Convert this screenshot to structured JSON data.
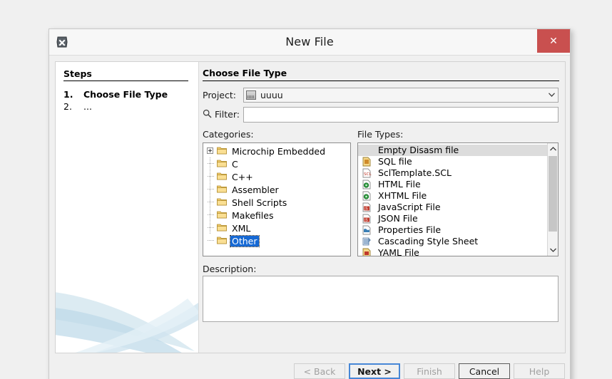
{
  "window": {
    "title": "New File",
    "icon": "app-badge-icon",
    "close_label": "✕",
    "close_color": "#c9504f"
  },
  "steps": {
    "heading": "Steps",
    "items": [
      {
        "number": "1.",
        "label": "Choose File Type"
      },
      {
        "number": "2.",
        "label": "..."
      }
    ]
  },
  "main": {
    "heading": "Choose File Type",
    "project": {
      "label": "Project:",
      "value": "uuuu",
      "icon": "project-icon",
      "arrow_icon": "chevron-down-icon"
    },
    "filter": {
      "label": "Filter:",
      "value": "",
      "placeholder": "",
      "icon": "search-icon"
    },
    "categories": {
      "label": "Categories:",
      "items": [
        {
          "label": "Microchip Embedded",
          "expandable": true,
          "selected": false
        },
        {
          "label": "C",
          "expandable": false,
          "selected": false
        },
        {
          "label": "C++",
          "expandable": false,
          "selected": false
        },
        {
          "label": "Assembler",
          "expandable": false,
          "selected": false
        },
        {
          "label": "Shell Scripts",
          "expandable": false,
          "selected": false
        },
        {
          "label": "Makefiles",
          "expandable": false,
          "selected": false
        },
        {
          "label": "XML",
          "expandable": false,
          "selected": false
        },
        {
          "label": "Other",
          "expandable": false,
          "selected": true
        }
      ]
    },
    "file_types": {
      "label": "File Types:",
      "items": [
        {
          "label": "Empty Disasm file",
          "icon": "",
          "selected": true
        },
        {
          "label": "SQL file",
          "icon": "sql-file-icon",
          "selected": false
        },
        {
          "label": "SclTemplate.SCL",
          "icon": "scl-file-icon",
          "selected": false
        },
        {
          "label": "HTML File",
          "icon": "html-file-icon",
          "selected": false
        },
        {
          "label": "XHTML File",
          "icon": "xhtml-file-icon",
          "selected": false
        },
        {
          "label": "JavaScript File",
          "icon": "js-file-icon",
          "selected": false
        },
        {
          "label": "JSON File",
          "icon": "json-file-icon",
          "selected": false
        },
        {
          "label": "Properties File",
          "icon": "properties-file-icon",
          "selected": false
        },
        {
          "label": "Cascading Style Sheet",
          "icon": "css-file-icon",
          "selected": false
        },
        {
          "label": "YAML File",
          "icon": "yaml-file-icon",
          "selected": false
        }
      ],
      "scrollbar": {
        "up_icon": "chevron-up-icon",
        "down_icon": "chevron-down-icon"
      }
    },
    "description": {
      "label": "Description:",
      "value": ""
    }
  },
  "footer": {
    "buttons": [
      {
        "label": "< Back",
        "state": "disabled"
      },
      {
        "label": "Next >",
        "state": "focused"
      },
      {
        "label": "Finish",
        "state": "disabled"
      },
      {
        "label": "Cancel",
        "state": "default"
      },
      {
        "label": "Help",
        "state": "disabled"
      }
    ]
  }
}
